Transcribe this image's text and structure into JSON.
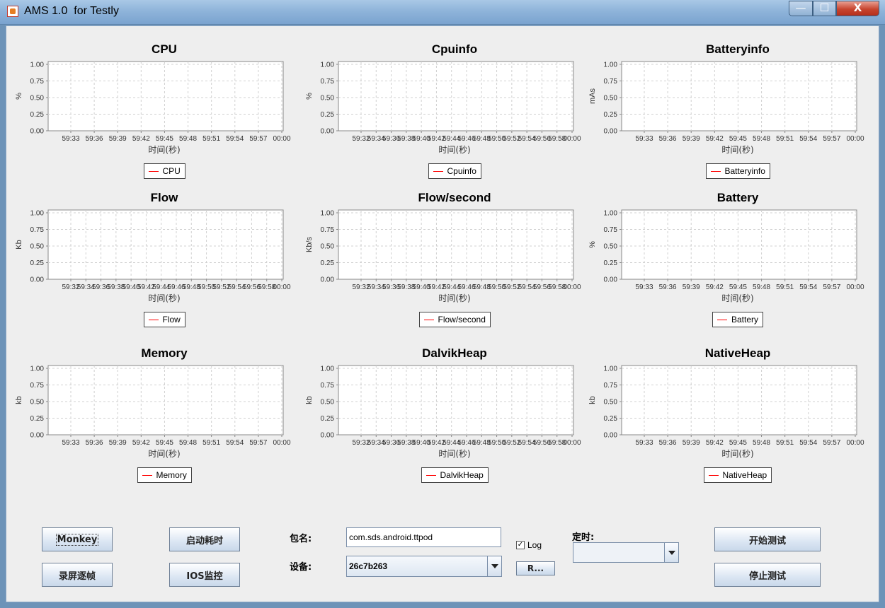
{
  "window": {
    "title": "AMS 1.0  for Testly",
    "min_glyph": "—",
    "max_glyph": "☐",
    "close_glyph": "X"
  },
  "chart_data": [
    {
      "type": "line",
      "title": "CPU",
      "ylabel": "%",
      "xlabel": "时间(秒)",
      "ylim": [
        0,
        1
      ],
      "yticks": [
        "0.00",
        "0.25",
        "0.50",
        "0.75",
        "1.00"
      ],
      "xticks": [
        "59:33",
        "59:36",
        "59:39",
        "59:42",
        "59:45",
        "59:48",
        "59:51",
        "59:54",
        "59:57",
        "00:00"
      ],
      "legend": "CPU",
      "series": [
        {
          "name": "CPU",
          "values": []
        }
      ],
      "grid": true,
      "legend_position": "bottom"
    },
    {
      "type": "line",
      "title": "Cpuinfo",
      "ylabel": "%",
      "xlabel": "时间(秒)",
      "ylim": [
        0,
        1
      ],
      "yticks": [
        "0.00",
        "0.25",
        "0.50",
        "0.75",
        "1.00"
      ],
      "xticks": [
        "59:32",
        "59:34",
        "59:36",
        "59:38",
        "59:40",
        "59:42",
        "59:44",
        "59:46",
        "59:48",
        "59:50",
        "59:52",
        "59:54",
        "59:56",
        "59:58",
        "00:00"
      ],
      "legend": "Cpuinfo",
      "series": [
        {
          "name": "Cpuinfo",
          "values": []
        }
      ],
      "grid": true,
      "legend_position": "bottom"
    },
    {
      "type": "line",
      "title": "Batteryinfo",
      "ylabel": "mAs",
      "xlabel": "时间(秒)",
      "ylim": [
        0,
        1
      ],
      "yticks": [
        "0.00",
        "0.25",
        "0.50",
        "0.75",
        "1.00"
      ],
      "xticks": [
        "59:33",
        "59:36",
        "59:39",
        "59:42",
        "59:45",
        "59:48",
        "59:51",
        "59:54",
        "59:57",
        "00:00"
      ],
      "legend": "Batteryinfo",
      "series": [
        {
          "name": "Batteryinfo",
          "values": []
        }
      ],
      "grid": true,
      "legend_position": "bottom"
    },
    {
      "type": "line",
      "title": "Flow",
      "ylabel": "Kb",
      "xlabel": "时间(秒)",
      "ylim": [
        0,
        1
      ],
      "yticks": [
        "0.00",
        "0.25",
        "0.50",
        "0.75",
        "1.00"
      ],
      "xticks": [
        "59:32",
        "59:34",
        "59:36",
        "59:38",
        "59:40",
        "59:42",
        "59:44",
        "59:46",
        "59:48",
        "59:50",
        "59:52",
        "59:54",
        "59:56",
        "59:58",
        "00:00"
      ],
      "legend": "Flow",
      "series": [
        {
          "name": "Flow",
          "values": []
        }
      ],
      "grid": true,
      "legend_position": "bottom"
    },
    {
      "type": "line",
      "title": "Flow/second",
      "ylabel": "Kb/s",
      "xlabel": "时间(秒)",
      "ylim": [
        0,
        1
      ],
      "yticks": [
        "0.00",
        "0.25",
        "0.50",
        "0.75",
        "1.00"
      ],
      "xticks": [
        "59:32",
        "59:34",
        "59:36",
        "59:38",
        "59:40",
        "59:42",
        "59:44",
        "59:46",
        "59:48",
        "59:50",
        "59:52",
        "59:54",
        "59:56",
        "59:58",
        "00:00"
      ],
      "legend": "Flow/second",
      "series": [
        {
          "name": "Flow/second",
          "values": []
        }
      ],
      "grid": true,
      "legend_position": "bottom"
    },
    {
      "type": "line",
      "title": "Battery",
      "ylabel": "%",
      "xlabel": "时间(秒)",
      "ylim": [
        0,
        1
      ],
      "yticks": [
        "0.00",
        "0.25",
        "0.50",
        "0.75",
        "1.00"
      ],
      "xticks": [
        "59:33",
        "59:36",
        "59:39",
        "59:42",
        "59:45",
        "59:48",
        "59:51",
        "59:54",
        "59:57",
        "00:00"
      ],
      "legend": "Battery",
      "series": [
        {
          "name": "Battery",
          "values": []
        }
      ],
      "grid": true,
      "legend_position": "bottom"
    },
    {
      "type": "line",
      "title": "Memory",
      "ylabel": "kb",
      "xlabel": "时间(秒)",
      "ylim": [
        0,
        1
      ],
      "yticks": [
        "0.00",
        "0.25",
        "0.50",
        "0.75",
        "1.00"
      ],
      "xticks": [
        "59:33",
        "59:36",
        "59:39",
        "59:42",
        "59:45",
        "59:48",
        "59:51",
        "59:54",
        "59:57",
        "00:00"
      ],
      "legend": "Memory",
      "series": [
        {
          "name": "Memory",
          "values": []
        }
      ],
      "grid": true,
      "legend_position": "bottom"
    },
    {
      "type": "line",
      "title": "DalvikHeap",
      "ylabel": "kb",
      "xlabel": "时间(秒)",
      "ylim": [
        0,
        1
      ],
      "yticks": [
        "0.00",
        "0.25",
        "0.50",
        "0.75",
        "1.00"
      ],
      "xticks": [
        "59:32",
        "59:34",
        "59:36",
        "59:38",
        "59:40",
        "59:42",
        "59:44",
        "59:46",
        "59:48",
        "59:50",
        "59:52",
        "59:54",
        "59:56",
        "59:58",
        "00:00"
      ],
      "legend": "DalvikHeap",
      "series": [
        {
          "name": "DalvikHeap",
          "values": []
        }
      ],
      "grid": true,
      "legend_position": "bottom"
    },
    {
      "type": "line",
      "title": "NativeHeap",
      "ylabel": "kb",
      "xlabel": "时间(秒)",
      "ylim": [
        0,
        1
      ],
      "yticks": [
        "0.00",
        "0.25",
        "0.50",
        "0.75",
        "1.00"
      ],
      "xticks": [
        "59:33",
        "59:36",
        "59:39",
        "59:42",
        "59:45",
        "59:48",
        "59:51",
        "59:54",
        "59:57",
        "00:00"
      ],
      "legend": "NativeHeap",
      "series": [
        {
          "name": "NativeHeap",
          "values": []
        }
      ],
      "grid": true,
      "legend_position": "bottom"
    }
  ],
  "controls": {
    "monkey_label": "Monkey",
    "record_label": "录屏逐帧",
    "startup_label": "启动耗时",
    "ios_label": "IOS监控",
    "package_label": "包名:",
    "package_value": "com.sds.android.ttpod",
    "device_label": "设备:",
    "device_value": "26c7b263",
    "log_label": "Log",
    "log_checked": "✓",
    "refresh_label": "R...",
    "timer_label": "定时:",
    "timer_value": "",
    "start_label": "开始测试",
    "stop_label": "停止测试"
  },
  "colors": {
    "series_line": "#ff0000",
    "plot_bg": "#ffffff",
    "grid": "#d0d0d0",
    "panel_bg": "#eeeeee"
  }
}
